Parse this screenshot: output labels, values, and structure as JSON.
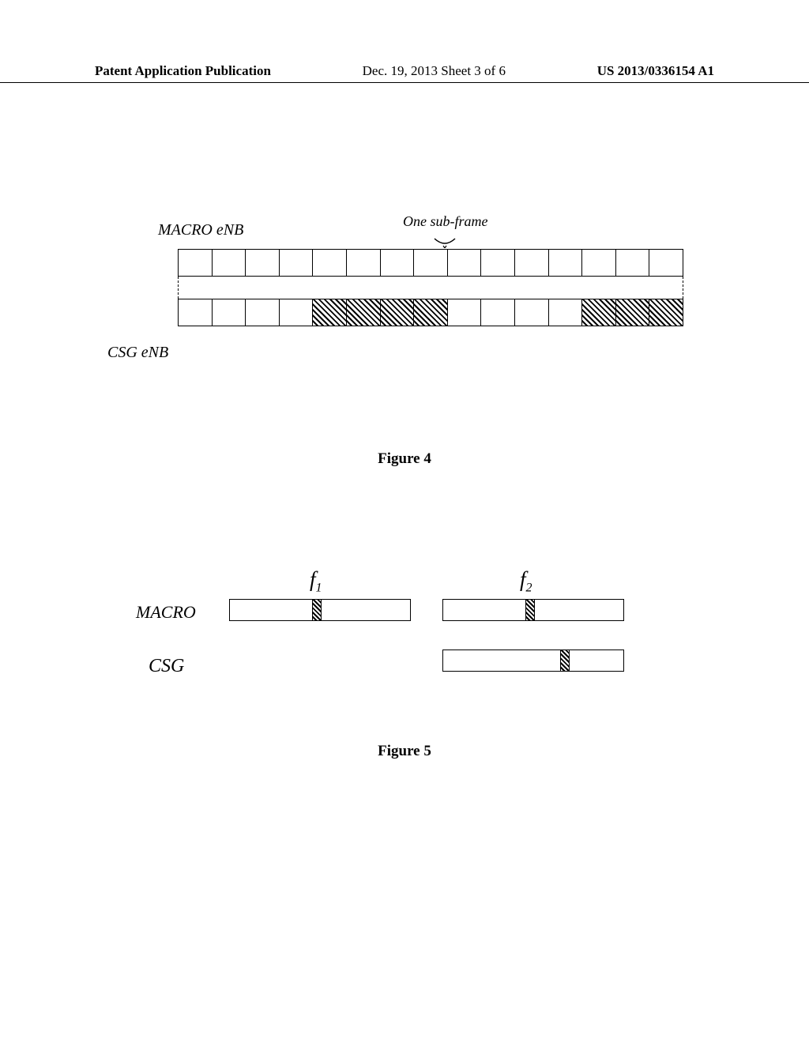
{
  "header": {
    "left": "Patent Application Publication",
    "mid": "Dec. 19, 2013  Sheet 3 of 6",
    "right": "US 2013/0336154 A1"
  },
  "figure4": {
    "labels": {
      "macro_enb": "MACRO eNB",
      "subframe": "One sub-frame",
      "csg_enb": "CSG eNB"
    },
    "caption": "Figure 4"
  },
  "figure5": {
    "labels": {
      "f1": "f",
      "f1_sub": "1",
      "f2": "f",
      "f2_sub": "2",
      "macro": "MACRO",
      "csg": "CSG"
    },
    "caption": "Figure 5"
  },
  "chart_data": [
    {
      "type": "table",
      "title": "Figure 4 - Sub-frame allocation diagram",
      "description": "Two frame rows of 15 sub-frames each. Top row (MACRO eNB) has no hatched sub-frames. Bottom row (CSG eNB) has sub-frames 5-8 and 13-15 hatched (reserved/blanked).",
      "rows": [
        {
          "name": "MACRO eNB",
          "subframes": 15,
          "hatched_indices": []
        },
        {
          "name": "CSG eNB",
          "subframes": 15,
          "hatched_indices": [
            5,
            6,
            7,
            8,
            13,
            14,
            15
          ]
        }
      ]
    },
    {
      "type": "table",
      "title": "Figure 5 - Frequency allocation diagram",
      "description": "Two frequency columns (f1, f2) against two rows (MACRO, CSG). MACRO has bars on both f1 and f2 with small hatched slice near center. CSG only has a bar on f2 with hatched slice offset right.",
      "grid": [
        {
          "row": "MACRO",
          "f1": "present",
          "f2": "present"
        },
        {
          "row": "CSG",
          "f1": "absent",
          "f2": "present"
        }
      ]
    }
  ]
}
